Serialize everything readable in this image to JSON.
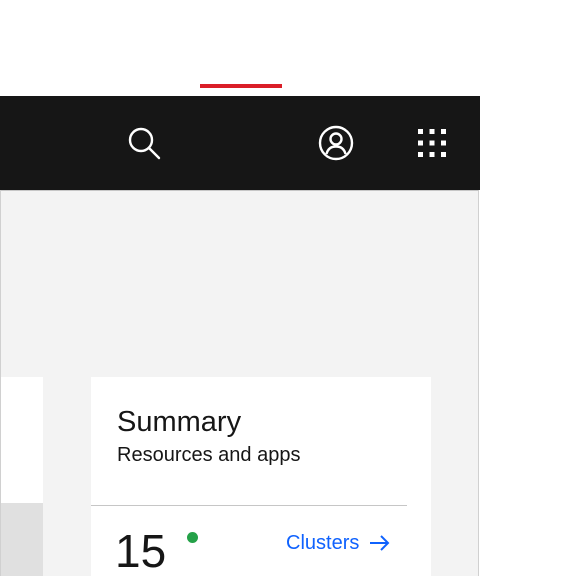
{
  "header": {
    "icons": {
      "search": "search-icon",
      "user": "user-avatar-icon",
      "switcher": "app-switcher-grid-icon"
    },
    "colors": {
      "background": "#161616",
      "accent": "#da1e28",
      "icon": "#ffffff"
    }
  },
  "summary": {
    "title": "Summary",
    "subtitle": "Resources and apps",
    "count": "15",
    "status_color": "#24a148",
    "link_label": "Clusters",
    "link_icon": "arrow-right-icon",
    "link_color": "#0f62fe"
  }
}
